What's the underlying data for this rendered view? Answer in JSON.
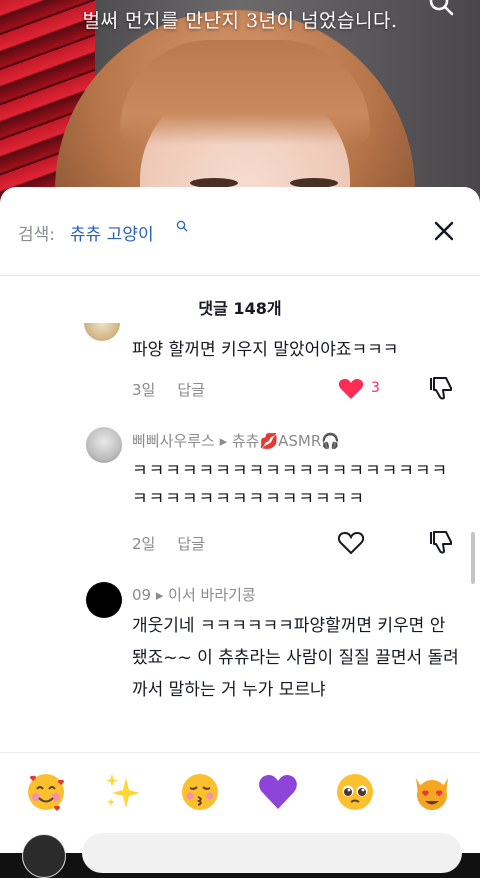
{
  "video": {
    "caption": "벌써 먼지를 만난지 3년이 넘었습니다."
  },
  "search": {
    "prefix": "검색:",
    "query": "츄츄 고양이"
  },
  "comments_count": "댓글 148개",
  "comments": [
    {
      "username": "",
      "text": "파양 할꺼면 키우지 말았어야죠ㅋㅋㅋ",
      "age": "3일",
      "reply": "답글",
      "likes": "3",
      "liked": true
    },
    {
      "username": "삐삐사우루스 ▸ 츄츄💋ASMR🎧",
      "text": "ㅋㅋㅋㅋㅋㅋㅋㅋㅋㅋㅋㅋㅋㅋㅋㅋㅋㅋㅋㅋㅋㅋㅋㅋㅋㅋㅋㅋㅋㅋㅋㅋㅋ",
      "age": "2일",
      "reply": "답글",
      "likes": "",
      "liked": false
    },
    {
      "username": "09 ▸ 이서 바라기콩",
      "text": "개웃기네 ㅋㅋㅋㅋㅋㅋ파양할꺼면 키우면 안 됐죠~~ 이 츄츄라는 사람이 질질 끌면서 돌려 까서 말하는 거 누가 모르냐"
    }
  ],
  "emojis": [
    "smiling-hearts",
    "sparkles",
    "kissing",
    "purple-heart",
    "pleading",
    "heart-eyes-cat"
  ],
  "colors": {
    "accent_blue": "#2a5fb8",
    "like_red": "#fe2c55",
    "muted": "#8a8b91"
  }
}
